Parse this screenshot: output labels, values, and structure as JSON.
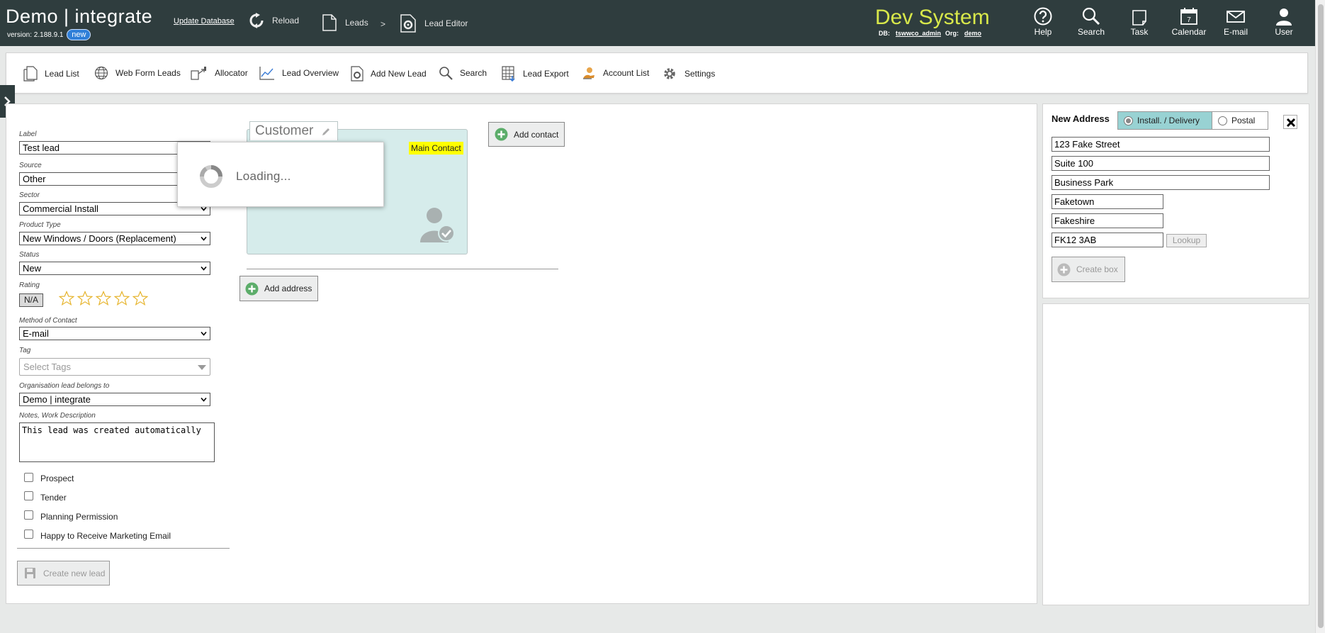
{
  "header": {
    "brand": "Demo | integrate",
    "update_db": "Update Database",
    "version_label": "version: 2.188.9.1",
    "new_badge": "new",
    "nav": {
      "reload": "Reload",
      "leads": "Leads",
      "separator": ">",
      "lead_editor": "Lead Editor"
    },
    "system_name": "Dev System",
    "db_label": "DB:",
    "db_value": "tswwco_admin",
    "org_label": "Org:",
    "org_value": "demo",
    "right_icons": {
      "help": "Help",
      "search": "Search",
      "task": "Task",
      "calendar": "Calendar",
      "email": "E-mail",
      "user": "User"
    },
    "calendar_day": "7"
  },
  "toolbar": {
    "lead_list": "Lead List",
    "web_form_leads": "Web Form Leads",
    "allocator": "Allocator",
    "lead_overview": "Lead Overview",
    "add_new_lead": "Add New Lead",
    "search": "Search",
    "lead_export": "Lead Export",
    "account_list": "Account List",
    "settings": "Settings"
  },
  "form": {
    "label": {
      "caption": "Label",
      "value": "Test lead"
    },
    "source": {
      "caption": "Source",
      "value": "Other"
    },
    "sector": {
      "caption": "Sector",
      "value": "Commercial Install"
    },
    "product_type": {
      "caption": "Product Type",
      "value": "New Windows / Doors (Replacement)"
    },
    "status": {
      "caption": "Status",
      "value": "New"
    },
    "rating": {
      "caption": "Rating",
      "value": "N/A",
      "stars_total": 5,
      "stars_filled": 0
    },
    "method_of_contact": {
      "caption": "Method of Contact",
      "value": "E-mail"
    },
    "tag": {
      "caption": "Tag",
      "placeholder": "Select Tags"
    },
    "organisation": {
      "caption": "Organisation lead belongs to",
      "value": "Demo | integrate"
    },
    "notes": {
      "caption": "Notes, Work Description",
      "value": "This lead was created automatically"
    },
    "checkboxes": {
      "prospect": "Prospect",
      "tender": "Tender",
      "planning_permission": "Planning Permission",
      "marketing_email": "Happy to Receive Marketing Email"
    },
    "create_button": "Create new lead"
  },
  "customer": {
    "tab_label": "Customer",
    "main_contact": "Main Contact",
    "add_contact": "Add contact",
    "add_address": "Add address"
  },
  "loading": {
    "text": "Loading..."
  },
  "address": {
    "title": "New Address",
    "type_install": "Install. / Delivery",
    "type_postal": "Postal",
    "line1": "123 Fake Street",
    "line2": "Suite 100",
    "line3": "Business Park",
    "town": "Faketown",
    "county": "Fakeshire",
    "postcode": "FK12 3AB",
    "lookup": "Lookup",
    "create_box": "Create box"
  },
  "colors": {
    "header_bg": "#2f3d3e",
    "dev_system": "#d8e84a",
    "card_bg": "#d6eceb",
    "selected_type": "#98d2d3",
    "highlight": "#ffff00"
  }
}
